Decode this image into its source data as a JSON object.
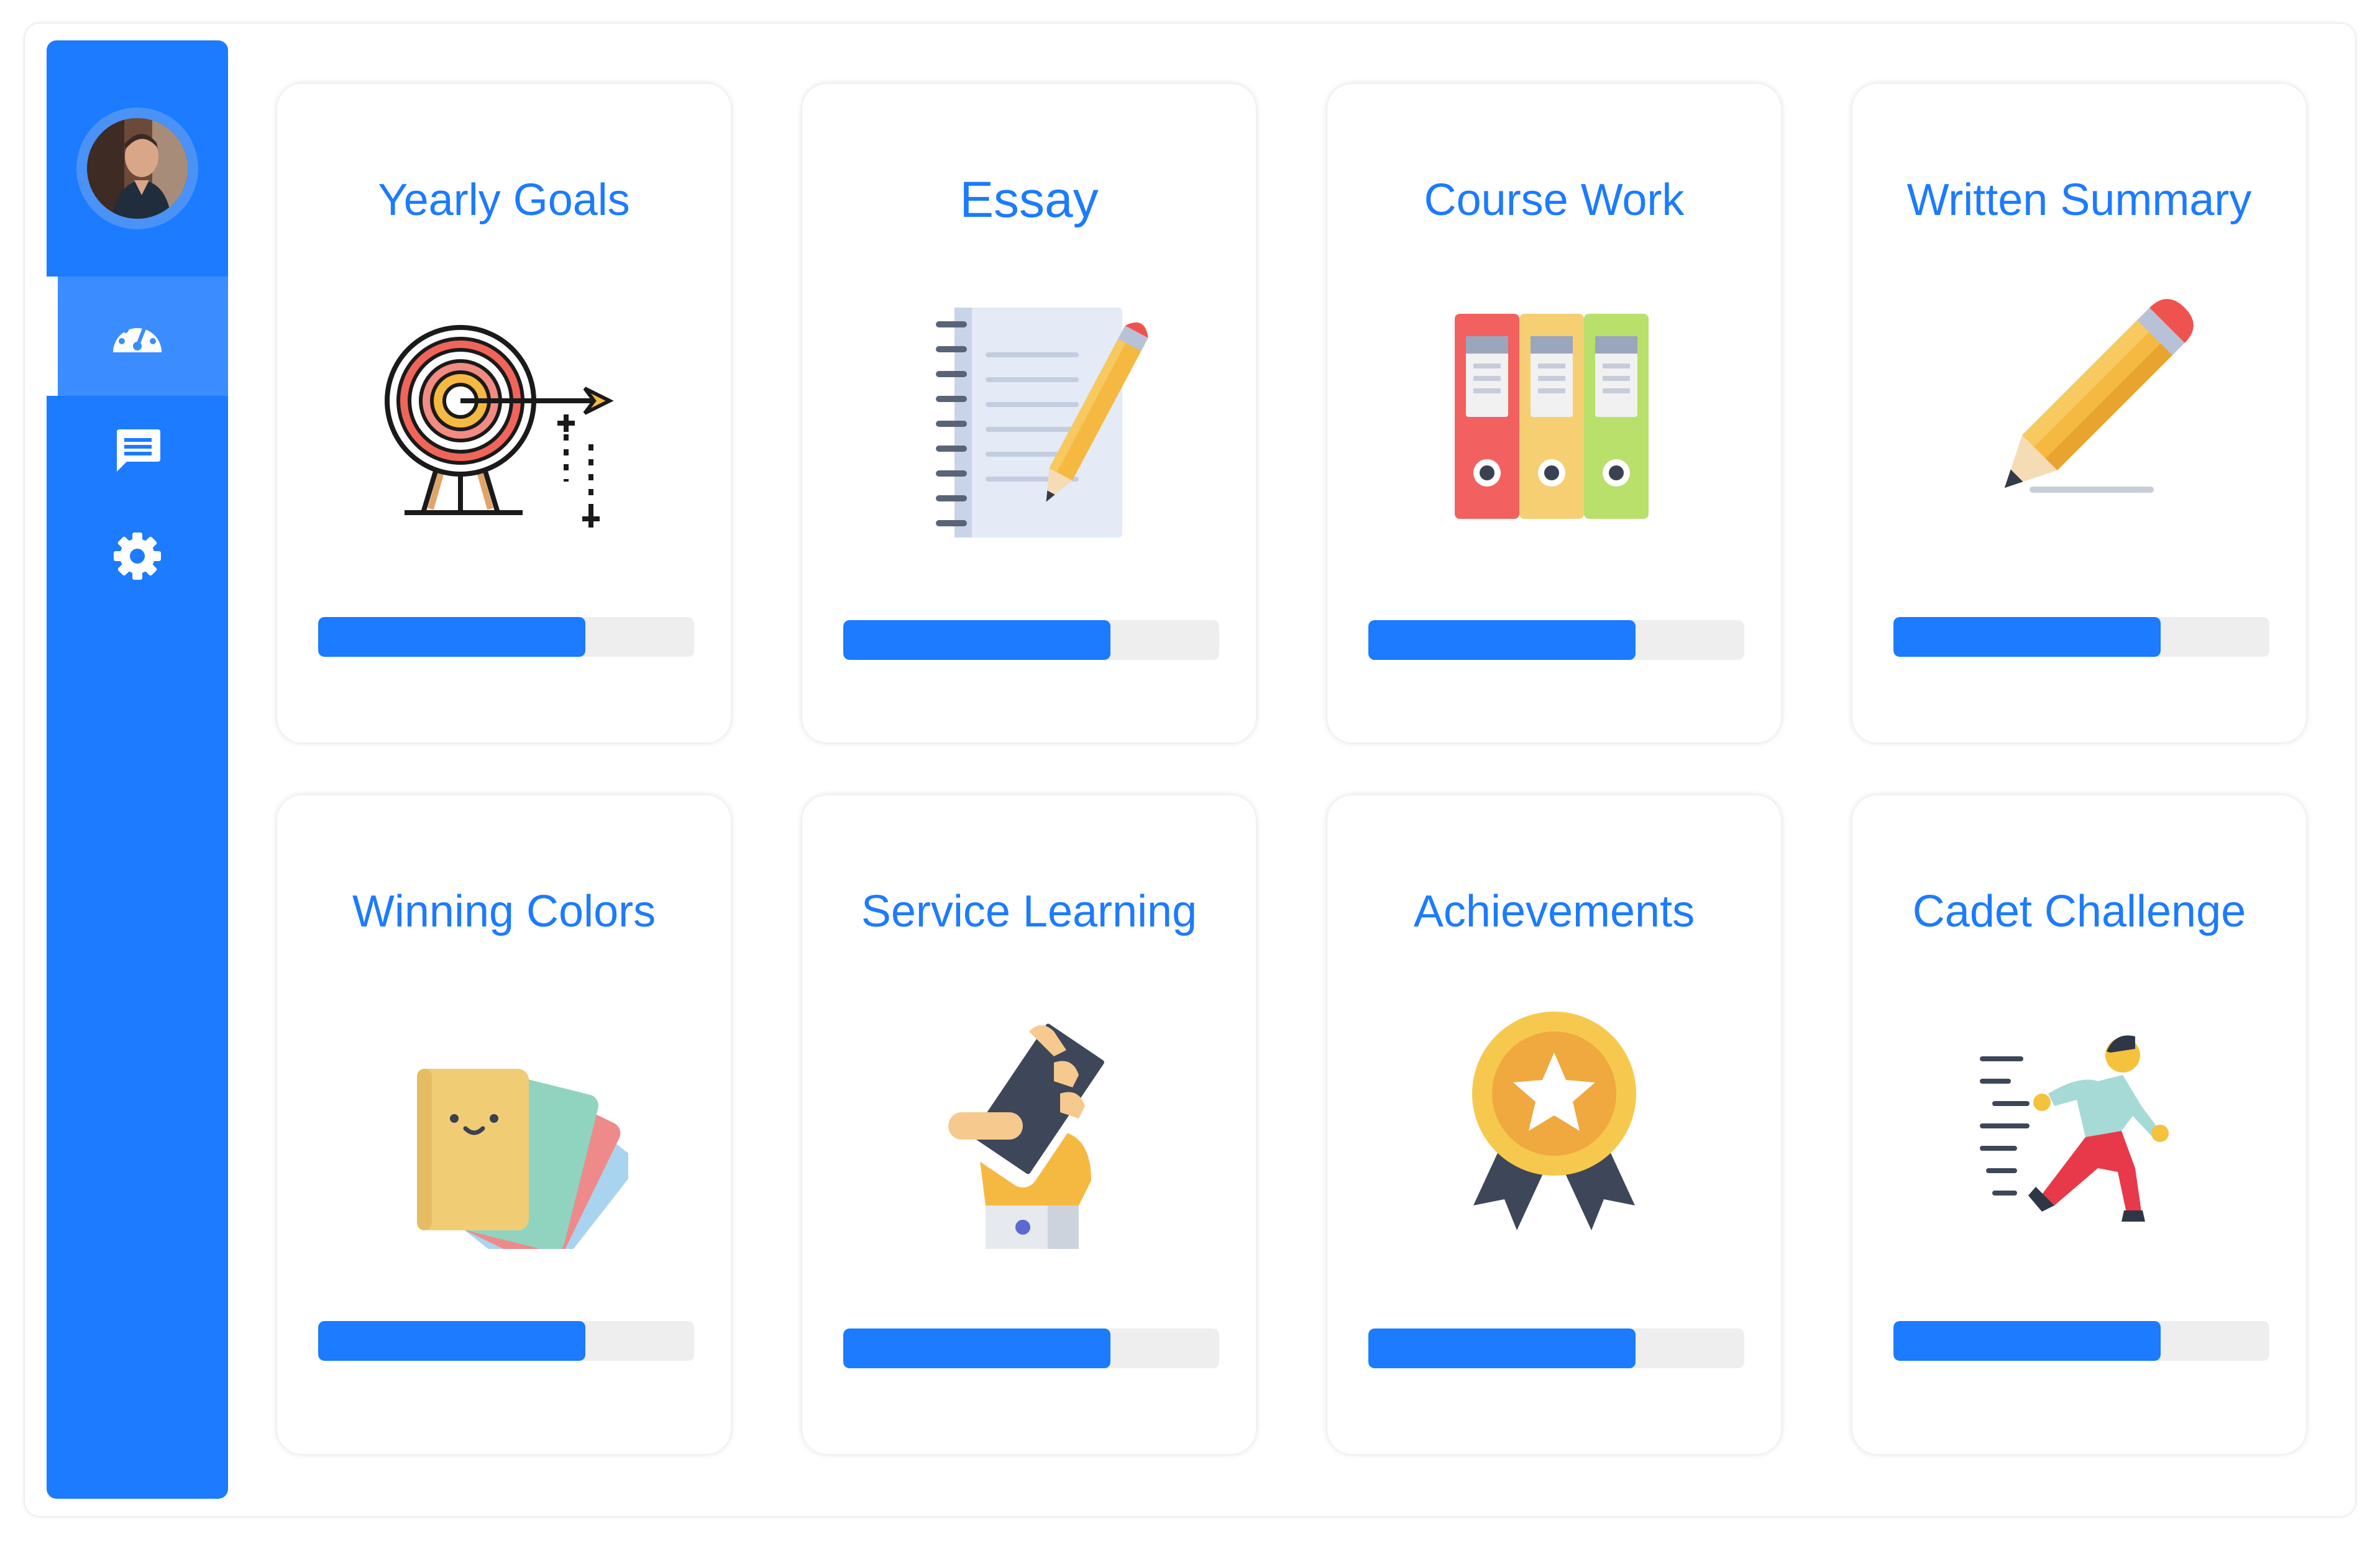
{
  "sidebar": {
    "avatar_alt": "User avatar",
    "nav": [
      {
        "icon": "dashboard-icon",
        "active": true
      },
      {
        "icon": "message-icon",
        "active": false
      },
      {
        "icon": "gear-icon",
        "active": false
      }
    ]
  },
  "colors": {
    "accent": "#1c7bff",
    "track": "#eeeeef",
    "title": "#1c7bff"
  },
  "cards": [
    {
      "title": "Yearly Goals",
      "icon": "target-icon",
      "progress": 0.71
    },
    {
      "title": "Essay",
      "icon": "notebook-pencil-icon",
      "progress": 0.71
    },
    {
      "title": "Course Work",
      "icon": "binders-icon",
      "progress": 0.71
    },
    {
      "title": "Written Summary",
      "icon": "pencil-icon",
      "progress": 0.71
    },
    {
      "title": "Winning Colors",
      "icon": "color-cards-icon",
      "progress": 0.71
    },
    {
      "title": "Service Learning",
      "icon": "phone-hand-icon",
      "progress": 0.71
    },
    {
      "title": "Achievements",
      "icon": "medal-icon",
      "progress": 0.71
    },
    {
      "title": "Cadet Challenge",
      "icon": "runner-icon",
      "progress": 0.71
    }
  ]
}
